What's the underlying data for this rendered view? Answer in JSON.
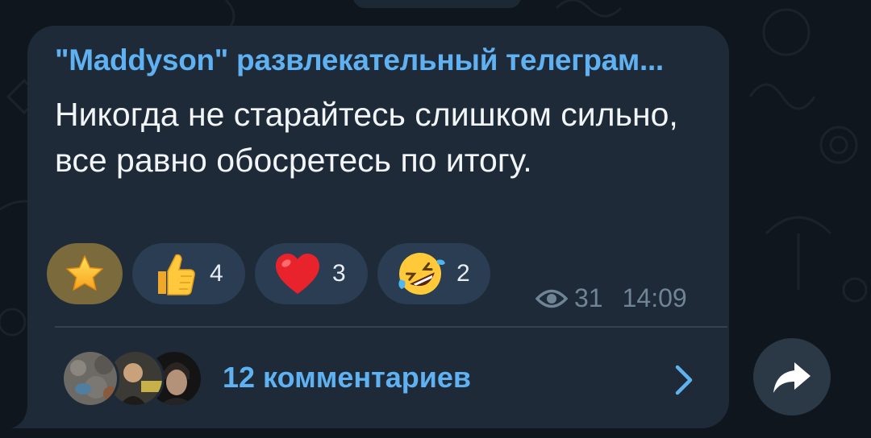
{
  "post": {
    "channel_name": "\"Maddyson\" развлекательный телеграм...",
    "text": "Никогда не старайтесь слишком сильно, все равно обосретесь по итогу."
  },
  "reactions": [
    {
      "icon": "star-icon",
      "count": ""
    },
    {
      "icon": "thumbs-up-icon",
      "count": "4"
    },
    {
      "icon": "red-heart-icon",
      "count": "3"
    },
    {
      "icon": "rofl-face-icon",
      "count": "2"
    }
  ],
  "meta": {
    "views": "31",
    "time": "14:09"
  },
  "comments": {
    "label": "12 комментариев"
  },
  "colors": {
    "background": "#0f161d",
    "bubble": "#1e2a37",
    "accent": "#5fb1f2",
    "reaction_pill": "#2b3d52",
    "meta_text": "#6f8596"
  }
}
